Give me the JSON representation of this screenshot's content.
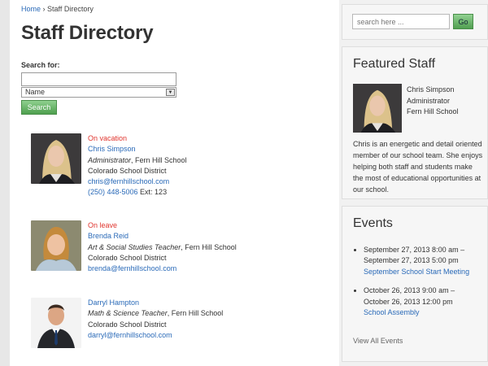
{
  "breadcrumb": {
    "home": "Home",
    "sep": "›",
    "current": "Staff Directory"
  },
  "page_title": "Staff Directory",
  "search_form": {
    "label": "Search for:",
    "input_value": "",
    "select_value": "Name",
    "button": "Search"
  },
  "staff": [
    {
      "status": "On vacation",
      "name": "Chris Simpson",
      "role": "Administrator",
      "school": ", Fern Hill School",
      "district": "Colorado School District",
      "email": "chris@fernhillschool.com",
      "phone": "(250) 448-5006",
      "ext": " Ext: 123"
    },
    {
      "status": "On leave",
      "name": "Brenda Reid",
      "role": "Art & Social Studies Teacher",
      "school": ", Fern Hill School",
      "district": "Colorado School District",
      "email": "brenda@fernhillschool.com"
    },
    {
      "name": "Darryl Hampton",
      "role": "Math & Science Teacher",
      "school": ", Fern Hill School",
      "district": "Colorado School District",
      "email": "darryl@fernhillschool.com"
    }
  ],
  "sidebar": {
    "search": {
      "placeholder": "search here ...",
      "button": "Go"
    },
    "featured": {
      "title": "Featured Staff",
      "name": "Chris Simpson",
      "role": "Administrator",
      "school": "Fern Hill School",
      "bio": "Chris is an energetic and detail oriented member of our school team. She enjoys helping both staff and students make the most of educational opportunities at our school."
    },
    "events": {
      "title": "Events",
      "items": [
        {
          "time": "September 27, 2013 8:00 am – September 27, 2013 5:00 pm",
          "title": "September School Start Meeting"
        },
        {
          "time": "October 26, 2013 9:00 am – October 26, 2013 12:00 pm",
          "title": "School Assembly"
        }
      ],
      "view_all": "View All Events"
    }
  },
  "colors": {
    "link": "#2a6ab8",
    "status": "#e0352e",
    "button_green": "#5fb15f"
  }
}
